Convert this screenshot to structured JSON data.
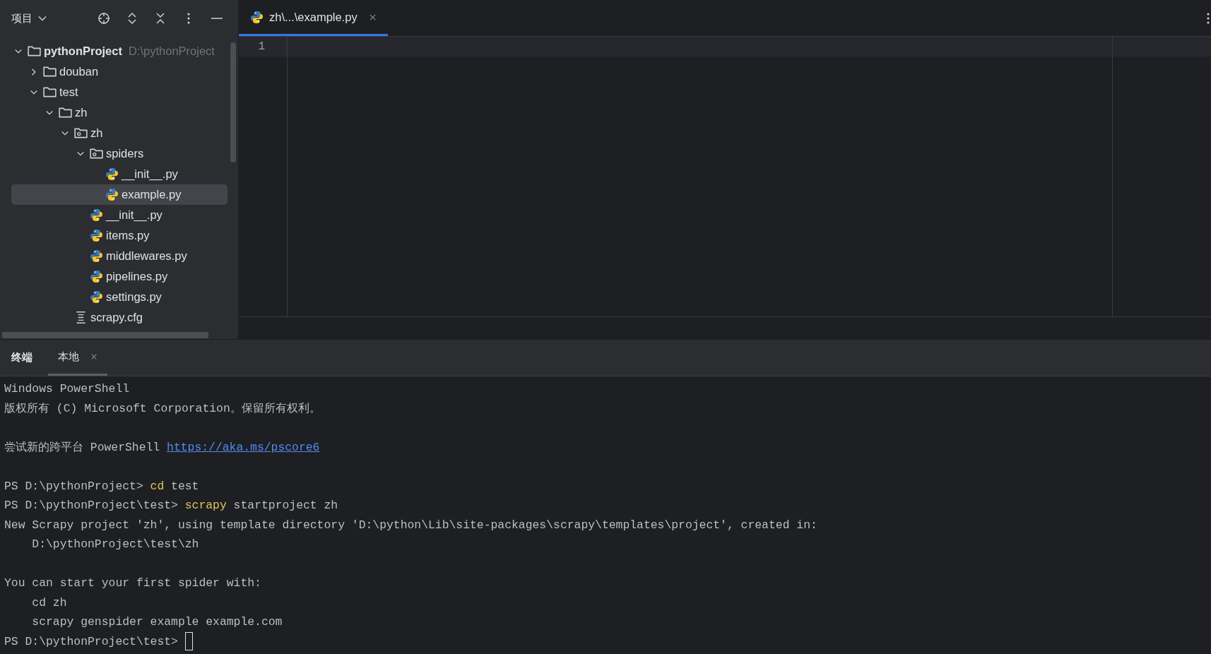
{
  "project_panel": {
    "title": "项目",
    "tree": [
      {
        "label": "pythonProject",
        "kind": "folder",
        "path": "D:\\pythonProject",
        "expanded": true,
        "selected": false,
        "children": [
          {
            "label": "douban",
            "kind": "folder",
            "expanded": false,
            "selected": false
          },
          {
            "label": "test",
            "kind": "folder",
            "expanded": true,
            "selected": false,
            "children": [
              {
                "label": "zh",
                "kind": "folder",
                "expanded": true,
                "selected": false,
                "children": [
                  {
                    "label": "zh",
                    "kind": "package",
                    "expanded": true,
                    "selected": false,
                    "children": [
                      {
                        "label": "spiders",
                        "kind": "package",
                        "expanded": true,
                        "selected": false,
                        "children": [
                          {
                            "label": "__init__.py",
                            "kind": "python",
                            "selected": false
                          },
                          {
                            "label": "example.py",
                            "kind": "python",
                            "selected": true
                          }
                        ]
                      },
                      {
                        "label": "__init__.py",
                        "kind": "python",
                        "selected": false
                      },
                      {
                        "label": "items.py",
                        "kind": "python",
                        "selected": false
                      },
                      {
                        "label": "middlewares.py",
                        "kind": "python",
                        "selected": false
                      },
                      {
                        "label": "pipelines.py",
                        "kind": "python",
                        "selected": false
                      },
                      {
                        "label": "settings.py",
                        "kind": "python",
                        "selected": false
                      }
                    ]
                  },
                  {
                    "label": "scrapy.cfg",
                    "kind": "config",
                    "selected": false
                  }
                ]
              }
            ]
          }
        ]
      }
    ]
  },
  "editor": {
    "tabs": [
      {
        "label": "zh\\...\\example.py",
        "selected": true
      }
    ],
    "line_numbers": [
      "1"
    ]
  },
  "terminal": {
    "title": "终端",
    "tabs": [
      {
        "label": "本地",
        "selected": true
      }
    ],
    "lines": [
      {
        "kind": "text",
        "segments": [
          {
            "text": "Windows PowerShell",
            "kind": "plain"
          }
        ]
      },
      {
        "kind": "text",
        "segments": [
          {
            "text": "版权所有 (C) Microsoft Corporation。保留所有权利。",
            "kind": "plain"
          }
        ]
      },
      {
        "kind": "blank"
      },
      {
        "kind": "text",
        "segments": [
          {
            "text": "尝试新的跨平台 PowerShell ",
            "kind": "plain"
          },
          {
            "text": "https://aka.ms/pscore6",
            "kind": "link"
          }
        ]
      },
      {
        "kind": "blank"
      },
      {
        "kind": "text",
        "segments": [
          {
            "text": "PS D:\\pythonProject> ",
            "kind": "plain"
          },
          {
            "text": "cd",
            "kind": "command"
          },
          {
            "text": " test",
            "kind": "plain"
          }
        ]
      },
      {
        "kind": "text",
        "segments": [
          {
            "text": "PS D:\\pythonProject\\test> ",
            "kind": "plain"
          },
          {
            "text": "scrapy",
            "kind": "command"
          },
          {
            "text": " startproject zh",
            "kind": "plain"
          }
        ]
      },
      {
        "kind": "text",
        "segments": [
          {
            "text": "New Scrapy project 'zh', using template directory 'D:\\python\\Lib\\site-packages\\scrapy\\templates\\project', created in:",
            "kind": "plain"
          }
        ]
      },
      {
        "kind": "text",
        "segments": [
          {
            "text": "    D:\\pythonProject\\test\\zh",
            "kind": "plain"
          }
        ]
      },
      {
        "kind": "blank"
      },
      {
        "kind": "text",
        "segments": [
          {
            "text": "You can start your first spider with:",
            "kind": "plain"
          }
        ]
      },
      {
        "kind": "text",
        "segments": [
          {
            "text": "    cd zh",
            "kind": "plain"
          }
        ]
      },
      {
        "kind": "text",
        "segments": [
          {
            "text": "    scrapy genspider example example.com",
            "kind": "plain"
          }
        ]
      },
      {
        "kind": "text",
        "cursor": true,
        "segments": [
          {
            "text": "PS D:\\pythonProject\\test> ",
            "kind": "plain"
          }
        ]
      }
    ]
  }
}
